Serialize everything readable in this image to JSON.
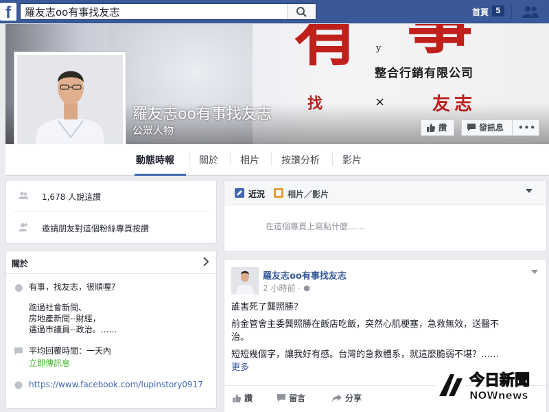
{
  "topbar": {
    "logo": "f",
    "search_value": "羅友志oo有事找友志",
    "home_label": "首頁",
    "home_count": "5"
  },
  "cover": {
    "big_char_1": "有",
    "big_char_2": "事",
    "small_y": "y",
    "company": "整合行銷有限公司",
    "find": "找",
    "times": "×",
    "friend": "友志"
  },
  "page": {
    "title": "羅友志oo有事找友志",
    "category": "公眾人物",
    "like_button": "讚",
    "message_button": "發訊息",
    "more_button": "•••"
  },
  "tabs": [
    "動態時報",
    "關於",
    "相片",
    "按讚分析",
    "影片"
  ],
  "left": {
    "likes_text": "1,678 人說這讚",
    "invite_text": "邀請朋友對這個粉絲專頁按讚",
    "about_title": "關於",
    "about_lines": [
      "有事，找友志，很順喔?",
      "跑過社會新聞、",
      "房地產新聞--財經，",
      "選過市議員--政治。……"
    ],
    "response_label": "平均回覆時間：一天內",
    "message_now": "立即傳訊息",
    "website": "https://www.facebook.com/lupinstory0917"
  },
  "composer": {
    "tab_status": "近況",
    "tab_photo": "相片／影片",
    "placeholder": "在這個專頁上寫點什麼……"
  },
  "post": {
    "author": "羅友志oo有事找友志",
    "time": "2 小時前 · ",
    "line1": "誰害死了龔照勝？",
    "line2a": "前金管會主委龔照勝在飯店吃飯，突然心肌梗塞，急救無效，送醫不",
    "line2b": "治。",
    "line3": "短短幾個字，讓我好有感。台灣的急救體系，就這麼脆弱不堪？……",
    "more": "更多",
    "action_like": "讚",
    "action_comment": "留言",
    "action_share": "分享"
  },
  "watermark": {
    "line1": "今日新聞",
    "line2": "NOWnews"
  },
  "colors": {
    "fb_blue": "#3b5998",
    "link_blue": "#365899",
    "cover_red": "#c0201b"
  }
}
